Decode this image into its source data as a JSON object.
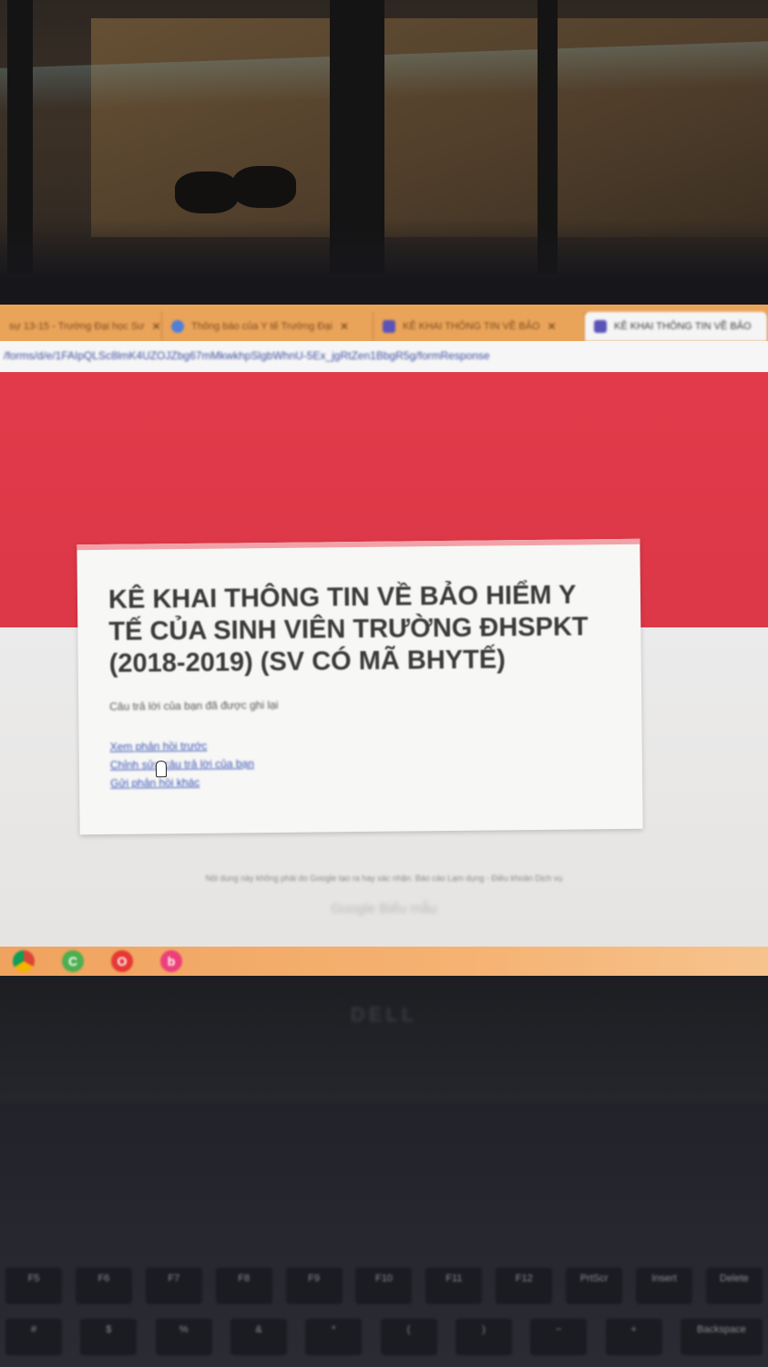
{
  "browser": {
    "tabs": [
      {
        "title": "sự 13-15 - Trường Đại học Sư",
        "active": false
      },
      {
        "title": "Thông báo của Y tế Trường Đại",
        "active": false
      },
      {
        "title": "KÊ KHAI THÔNG TIN VỀ BẢO",
        "active": false
      },
      {
        "title": "KÊ KHAI THÔNG TIN VỀ BẢO",
        "active": true
      }
    ],
    "url": "/forms/d/e/1FAIpQLSc8lmK4UZOJZbg67mMkwkhpSlgbWhnU-5Ex_jgRtZen1BbgR5g/formResponse"
  },
  "form": {
    "title": "KÊ KHAI THÔNG TIN VỀ BẢO HIỂM Y TẾ CỦA SINH VIÊN TRƯỜNG ĐHSPKT (2018-2019) (SV CÓ MÃ BHYTẾ)",
    "confirmation": "Câu trả lời của bạn đã được ghi lại",
    "links": {
      "view_previous": "Xem phản hồi trước",
      "edit_response": "Chỉnh sửa câu trả lời của bạn",
      "submit_another": "Gửi phản hồi khác"
    },
    "footer_note": "Nội dung này không phải do Google tạo ra hay xác nhận. Báo cáo Lạm dụng - Điều khoản Dịch vụ",
    "logo_text": "Google Biểu mẫu"
  },
  "laptop": {
    "brand": "DELL",
    "fn_keys": [
      "F5",
      "F6",
      "F7",
      "F8",
      "F9",
      "F10",
      "F11",
      "F12",
      "PrtScr",
      "Insert",
      "Delete"
    ],
    "bottom_keys": [
      "#",
      "$",
      "%",
      "&",
      "*",
      "(",
      ")",
      "−",
      "+",
      "Backspace"
    ]
  },
  "colors": {
    "form_accent": "#dc3847",
    "tabbar": "#e9a45a",
    "link": "#3b55b8"
  }
}
